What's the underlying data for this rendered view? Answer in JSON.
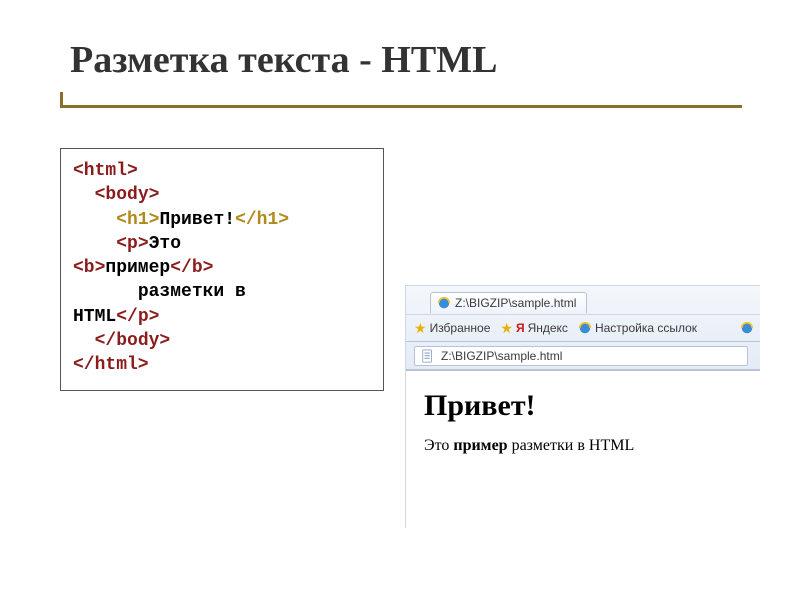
{
  "title": "Разметка текста - HTML",
  "code": {
    "tag_html_open": "<html>",
    "tag_body_open": "<body>",
    "tag_h1_open": "<h1>",
    "h1_text": "Привет!",
    "tag_h1_close": "</h1>",
    "tag_p_open": "<p>",
    "p_text_1": "Это",
    "tag_b_open": "<b>",
    "b_text": "пример",
    "tag_b_close": "</b>",
    "p_text_2": "разметки в",
    "p_text_3": "HTML",
    "tag_p_close": "</p>",
    "tag_body_close": "</body>",
    "tag_html_close": "</html>"
  },
  "browser": {
    "tab_label": "Z:\\BIGZIP\\sample.html",
    "favorites_label": "Избранное",
    "yandex_label": "Яндекс",
    "links_setup_label": "Настройка ссылок",
    "address": "Z:\\BIGZIP\\sample.html",
    "page_heading": "Привет!",
    "page_p_before": "Это ",
    "page_p_bold": "пример",
    "page_p_after": " разметки в HTML"
  }
}
